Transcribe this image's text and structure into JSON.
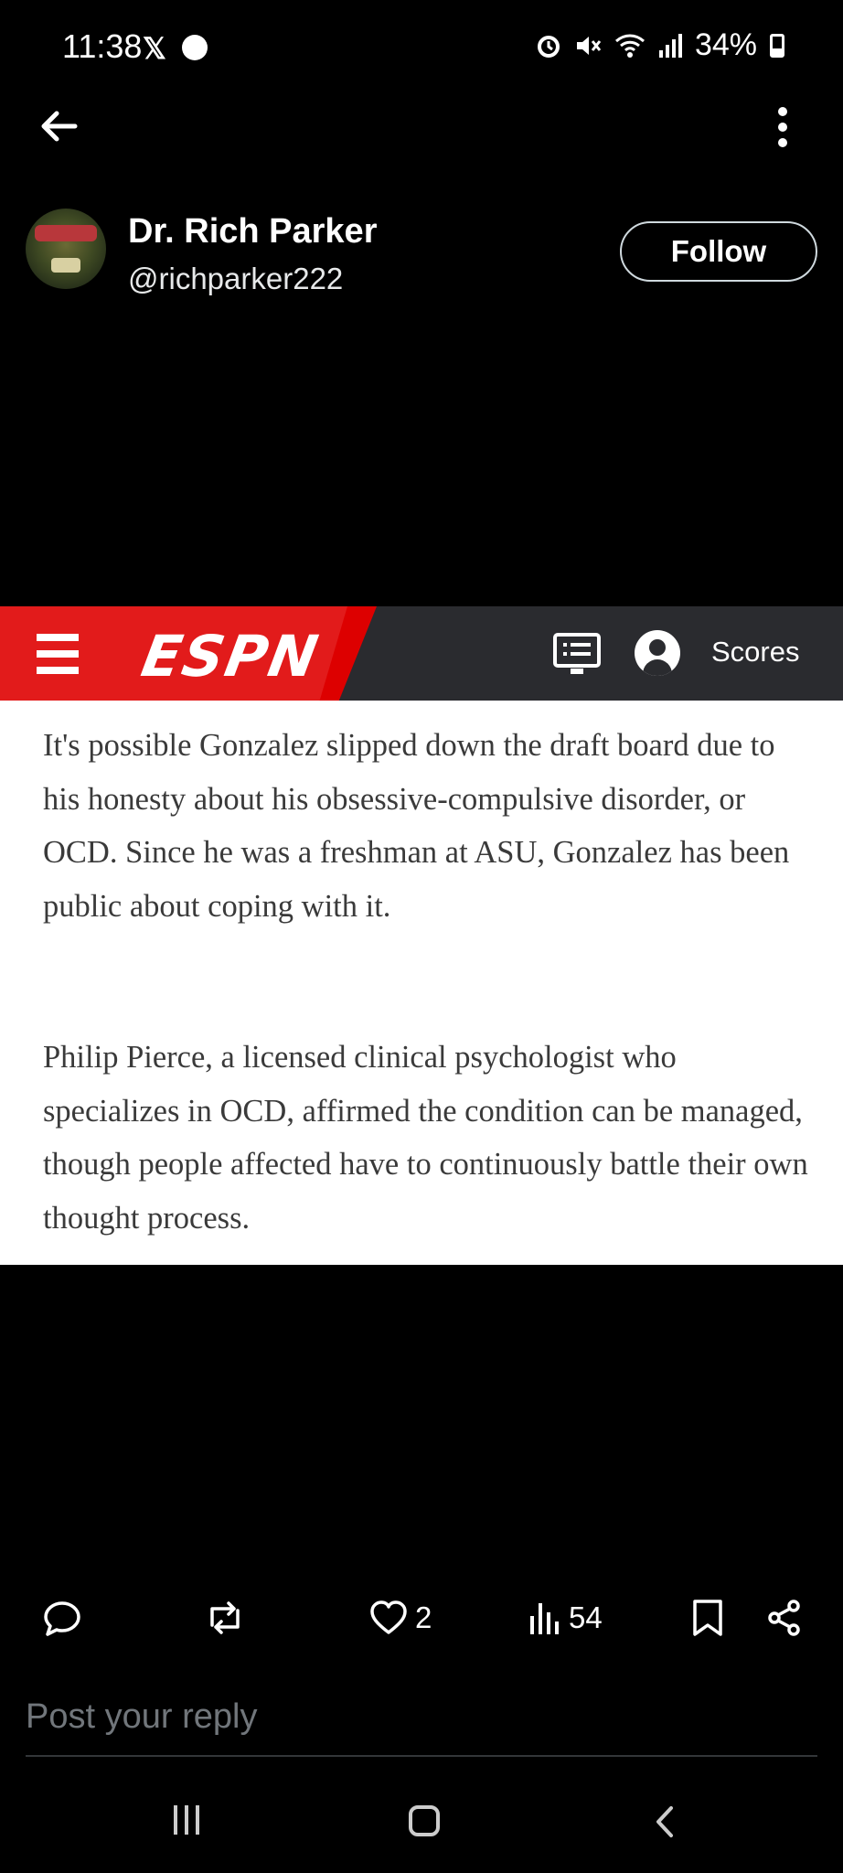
{
  "status_bar": {
    "time": "11:38",
    "x_glyph": "𝕏",
    "battery": "34%",
    "icons": [
      "x-icon",
      "messenger-icon",
      "alarm-icon",
      "mute-icon",
      "wifi-icon",
      "signal-icon",
      "battery-icon"
    ]
  },
  "profile": {
    "display_name": "Dr. Rich Parker",
    "handle": "@richparker222",
    "follow_label": "Follow"
  },
  "espn": {
    "logo": "ESPN",
    "scores_label": "Scores",
    "accent": "#e21b1b",
    "bar_color": "#2a2b2f"
  },
  "article": {
    "paragraph1": "It's possible Gonzalez slipped down the draft board due to his honesty about his obsessive-compulsive disorder, or OCD. Since he was a freshman at ASU, Gonzalez has been public about coping with it.",
    "paragraph2": "Philip Pierce, a licensed clinical psychologist who specializes in OCD, affirmed the condition can be managed, though people affected have to continuously battle their own thought process."
  },
  "actions": {
    "likes": "2",
    "views": "54"
  },
  "reply": {
    "placeholder": "Post your reply"
  }
}
